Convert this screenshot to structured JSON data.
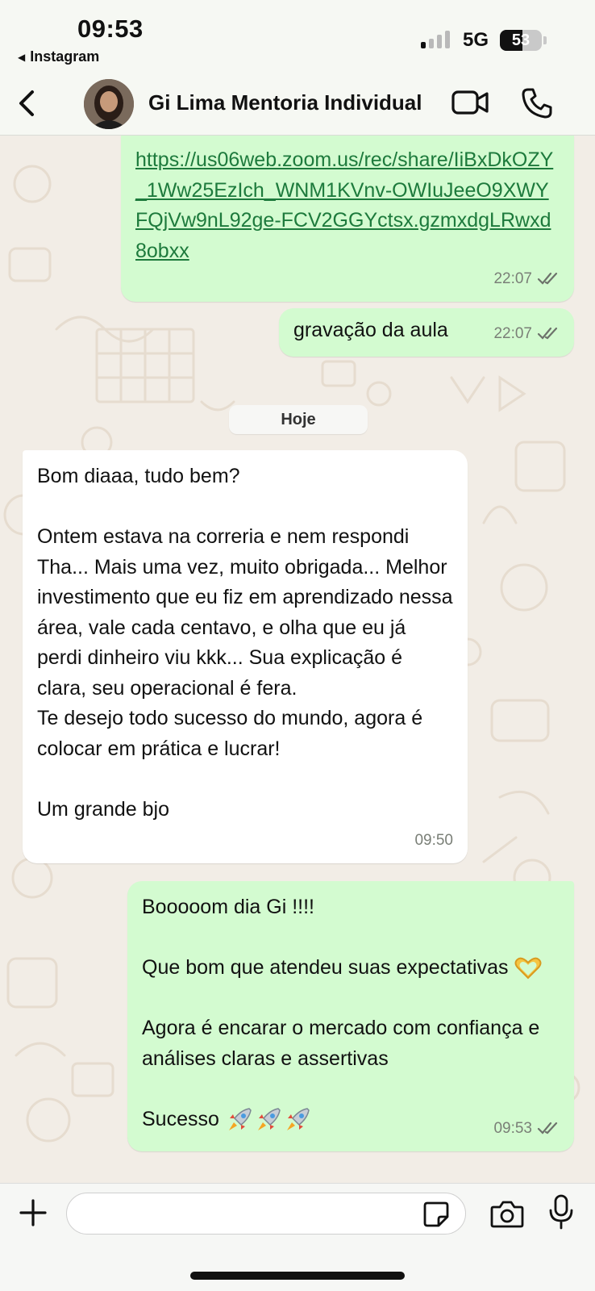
{
  "status_bar": {
    "time": "09:53",
    "back_app": "Instagram",
    "network": "5G",
    "battery": "53",
    "battery_level": 0.53
  },
  "header": {
    "contact_name": "Gi Lima Mentoria Individual"
  },
  "messages": [
    {
      "direction": "outgoing",
      "link": "https://us06web.zoom.us/rec/share/IiBxDkOZY_1Ww25EzIch_WNM1KVnv-OWIuJeeO9XWYFQjVw9nL92ge-FCV2GGYctsx.gzmxdgLRwxd8obxx",
      "time": "22:07",
      "status": "read"
    },
    {
      "direction": "outgoing",
      "text": "gravação da aula",
      "time": "22:07",
      "status": "read"
    },
    {
      "direction": "incoming",
      "text": "Bom diaaa, tudo bem?\n\nOntem estava na correria e nem respondi Tha... Mais uma vez, muito obrigada... Melhor investimento que eu fiz em aprendizado nessa área, vale cada centavo, e olha que eu já perdi dinheiro viu kkk... Sua explicação é clara, seu operacional é fera.\nTe desejo todo sucesso do mundo, agora é colocar em prática e lucrar!\n\nUm grande bjo",
      "time": "09:50"
    },
    {
      "direction": "outgoing",
      "line1": "Booooom dia Gi !!!!",
      "line2": "Que bom que atendeu suas expectativas",
      "line3": "Agora é encarar o mercado com confiança e análises claras e assertivas",
      "line4": "Sucesso",
      "time": "09:53",
      "status": "read"
    }
  ],
  "day_divider": "Hoje",
  "input": {
    "placeholder": "",
    "value": ""
  },
  "icons": {
    "back": "chevron-left-icon",
    "video": "video-camera-icon",
    "phone": "phone-icon",
    "plus": "plus-icon",
    "sticker": "sticker-icon",
    "camera": "camera-icon",
    "mic": "microphone-icon",
    "heart_hands": "heart-hands-emoji",
    "rocket": "rocket-emoji"
  },
  "colors": {
    "outgoing_bubble": "#d3fbd0",
    "incoming_bubble": "#ffffff",
    "link": "#1d7a3c",
    "header_bg": "#f6f8f3",
    "wallpaper": "#f2ede6"
  }
}
